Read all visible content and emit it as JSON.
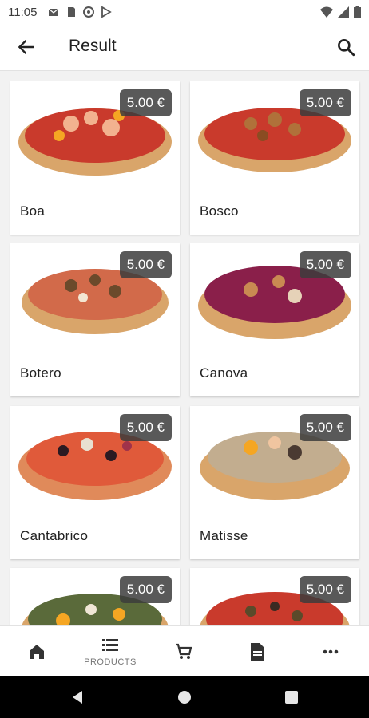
{
  "status_bar": {
    "time": "11:05"
  },
  "app_bar": {
    "title": "Result"
  },
  "products": [
    {
      "name": "Boa",
      "price": "5.00 €"
    },
    {
      "name": "Bosco",
      "price": "5.00 €"
    },
    {
      "name": "Botero",
      "price": "5.00 €"
    },
    {
      "name": "Canova",
      "price": "5.00 €"
    },
    {
      "name": "Cantabrico",
      "price": "5.00 €"
    },
    {
      "name": "Matisse",
      "price": "5.00 €"
    },
    {
      "name": "",
      "price": "5.00 €"
    },
    {
      "name": "",
      "price": "5.00 €"
    }
  ],
  "bottom_nav": [
    {
      "icon": "home-icon",
      "label": ""
    },
    {
      "icon": "list-icon",
      "label": "PRODUCTS"
    },
    {
      "icon": "cart-icon",
      "label": ""
    },
    {
      "icon": "document-icon",
      "label": ""
    },
    {
      "icon": "more-icon",
      "label": ""
    }
  ],
  "colors": {
    "price_badge": "#3c3c3c",
    "background": "#f2f2f2",
    "card": "#ffffff"
  }
}
